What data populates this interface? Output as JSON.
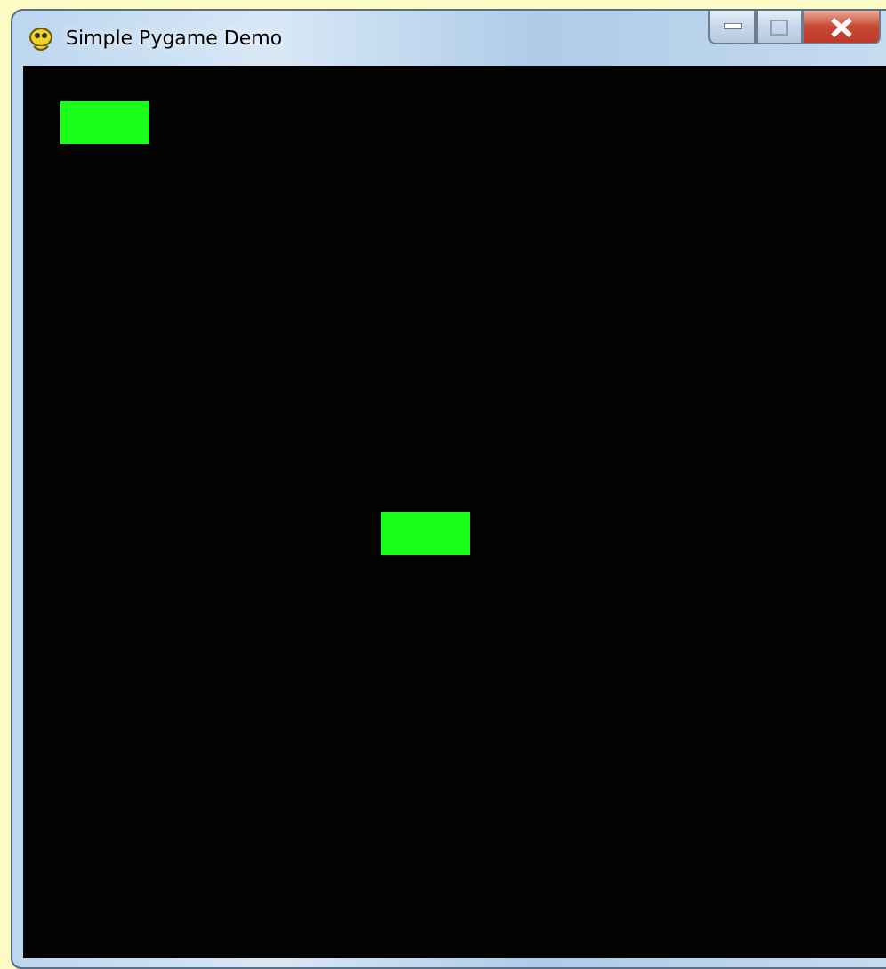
{
  "window": {
    "title": "Simple Pygame Demo"
  },
  "canvas": {
    "sprites": [
      {
        "kind": "rect",
        "color": "#1aff1a"
      },
      {
        "kind": "rect",
        "color": "#1aff1a"
      }
    ]
  }
}
